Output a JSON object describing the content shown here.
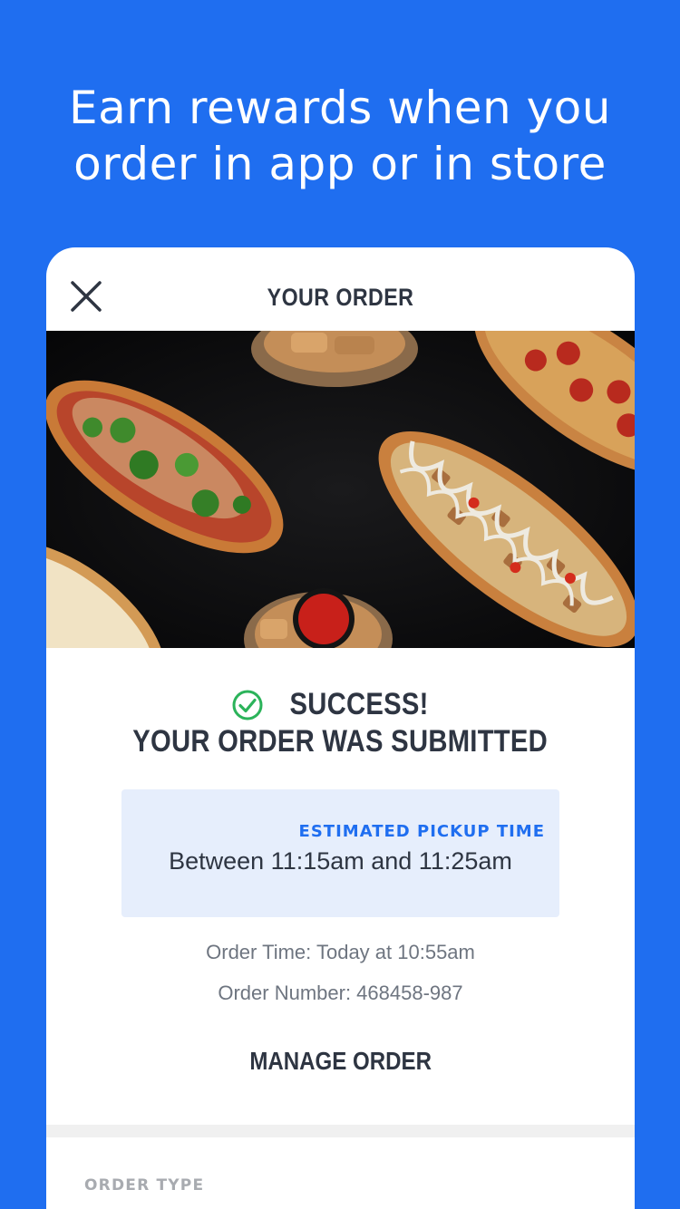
{
  "promo": {
    "headline_line1": "Earn rewards when you",
    "headline_line2": "order in app or in store"
  },
  "card": {
    "close_icon": "close-icon",
    "title": "YOUR ORDER",
    "hero_image": "pizza-flatbreads-photo"
  },
  "status": {
    "icon": "check-circle-icon",
    "line1": "SUCCESS!",
    "line2": "YOUR ORDER WAS SUBMITTED"
  },
  "pickup": {
    "label": "ESTIMATED PICKUP TIME",
    "time": "Between 11:15am and 11:25am"
  },
  "order": {
    "time": "Order Time: Today at 10:55am",
    "number": "Order Number: 468458-987"
  },
  "actions": {
    "manage_order": "MANAGE ORDER"
  },
  "sections": {
    "order_type_label": "ORDER TYPE"
  },
  "colors": {
    "brand_blue": "#1f6ef0",
    "text_dark": "#2e3542",
    "success_green": "#2bb35a",
    "pickup_bg": "#e6eefc"
  }
}
